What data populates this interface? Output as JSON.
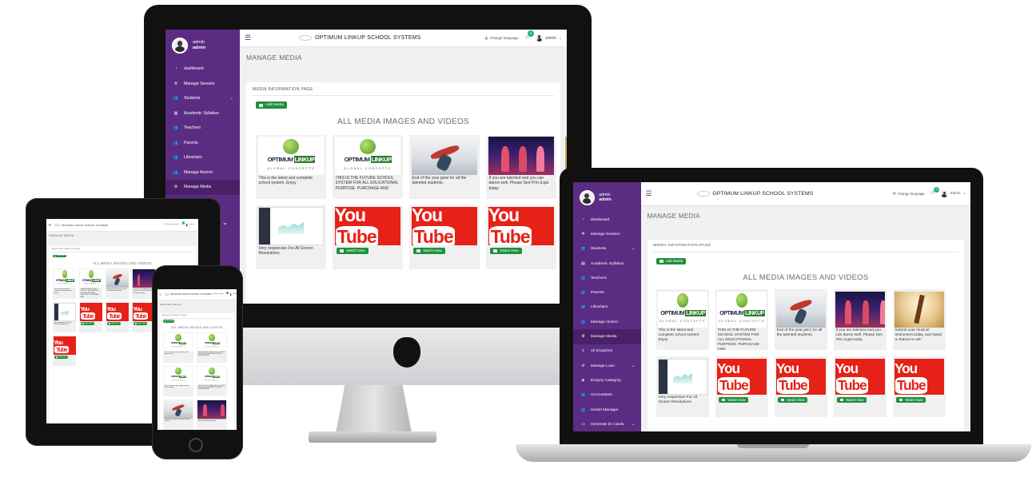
{
  "app": {
    "title": "OPTIMUM LINKUP SCHOOL SYSTEMS",
    "change_language": "Change language",
    "notif_count": "9",
    "user_label": "admin",
    "sidebar": {
      "user_role": "admin",
      "user_name": "admin",
      "items": [
        {
          "label": "dashboard",
          "icon": "dashboard-icon"
        },
        {
          "label": "Manage Session",
          "icon": "gear-icon"
        },
        {
          "label": "Students",
          "icon": "users-icon",
          "expandable": true
        },
        {
          "label": "Academic Syllabus",
          "icon": "book-icon"
        },
        {
          "label": "Teachers",
          "icon": "users-icon"
        },
        {
          "label": "Parents",
          "icon": "users-icon"
        },
        {
          "label": "Librarians",
          "icon": "users-icon"
        },
        {
          "label": "Manage Alumni",
          "icon": "users-icon"
        },
        {
          "label": "Manage Media",
          "icon": "media-icon",
          "active": true
        },
        {
          "label": "All Enquiries",
          "icon": "list-icon"
        },
        {
          "label": "Manage Loan",
          "icon": "loan-icon",
          "expandable": true
        },
        {
          "label": "Enquiry Category",
          "icon": "category-icon"
        },
        {
          "label": "Accountants",
          "icon": "users-icon"
        },
        {
          "label": "Hostel Manager",
          "icon": "users-icon"
        },
        {
          "label": "Generate ID Cards",
          "icon": "id-card-icon",
          "expandable": true
        }
      ]
    },
    "page_title": "MANAGE MEDIA",
    "panel_heading": "MEDIA INFORMATION PAGE",
    "add_media": "Add Media",
    "grid_title": "ALL MEDIA IMAGES AND VIDEOS",
    "watch_now": "Watch Now",
    "logo": {
      "word1": "OPTIMUM",
      "word2": "LINKUP",
      "sub": "GLOBAL CONCEPTS"
    },
    "youtube": {
      "you": "You",
      "tube": "Tube"
    },
    "media": [
      {
        "thumb": "logo",
        "caption": "This is the latest and complete school system. Enjoy"
      },
      {
        "thumb": "logo",
        "caption": "THIS IS THE FUTURE SCHOOL SYSTEM FOR ALL EDUCATIONAL PURPOSE. PURCHASE AND"
      },
      {
        "thumb": "dance1",
        "caption": "End of the year jamz for all the talented students."
      },
      {
        "thumb": "dance2",
        "caption": "If you are talented and you can dance well, Please See Prin d.gal today"
      },
      {
        "thumb": "music",
        "caption": "Submit your musical instrument today, and stand a chance to win"
      },
      {
        "thumb": "dash",
        "caption": "Very responsive For All Screen Resolutions"
      },
      {
        "thumb": "yt",
        "caption": ""
      },
      {
        "thumb": "yt",
        "caption": ""
      },
      {
        "thumb": "yt",
        "caption": ""
      },
      {
        "thumb": "yt",
        "caption": ""
      }
    ]
  },
  "colors": {
    "sidebar": "#5b2d82",
    "accent_green": "#1e8f3e",
    "youtube_red": "#e62117"
  }
}
